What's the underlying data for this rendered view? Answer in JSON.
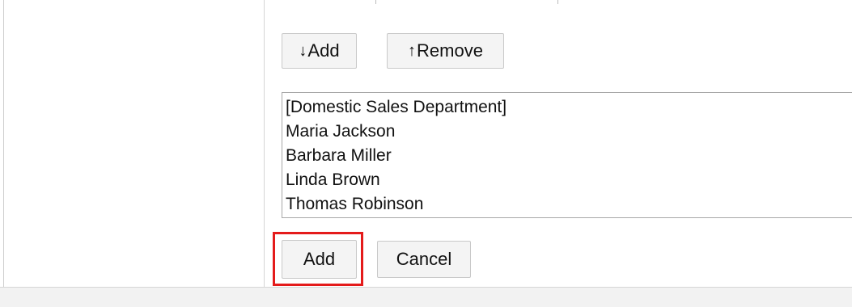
{
  "member_buttons": {
    "add": {
      "arrow": "↓",
      "label": "Add"
    },
    "remove": {
      "arrow": "↑",
      "label": "Remove"
    }
  },
  "selected_list": {
    "items": [
      "[Domestic Sales Department]",
      "Maria Jackson",
      "Barbara Miller",
      "Linda Brown",
      "Thomas Robinson"
    ]
  },
  "footer_buttons": {
    "add_label": "Add",
    "cancel_label": "Cancel"
  },
  "colors": {
    "highlight": "#e41b1b",
    "button_bg": "#f4f4f4",
    "divider": "#d6d6d6"
  }
}
